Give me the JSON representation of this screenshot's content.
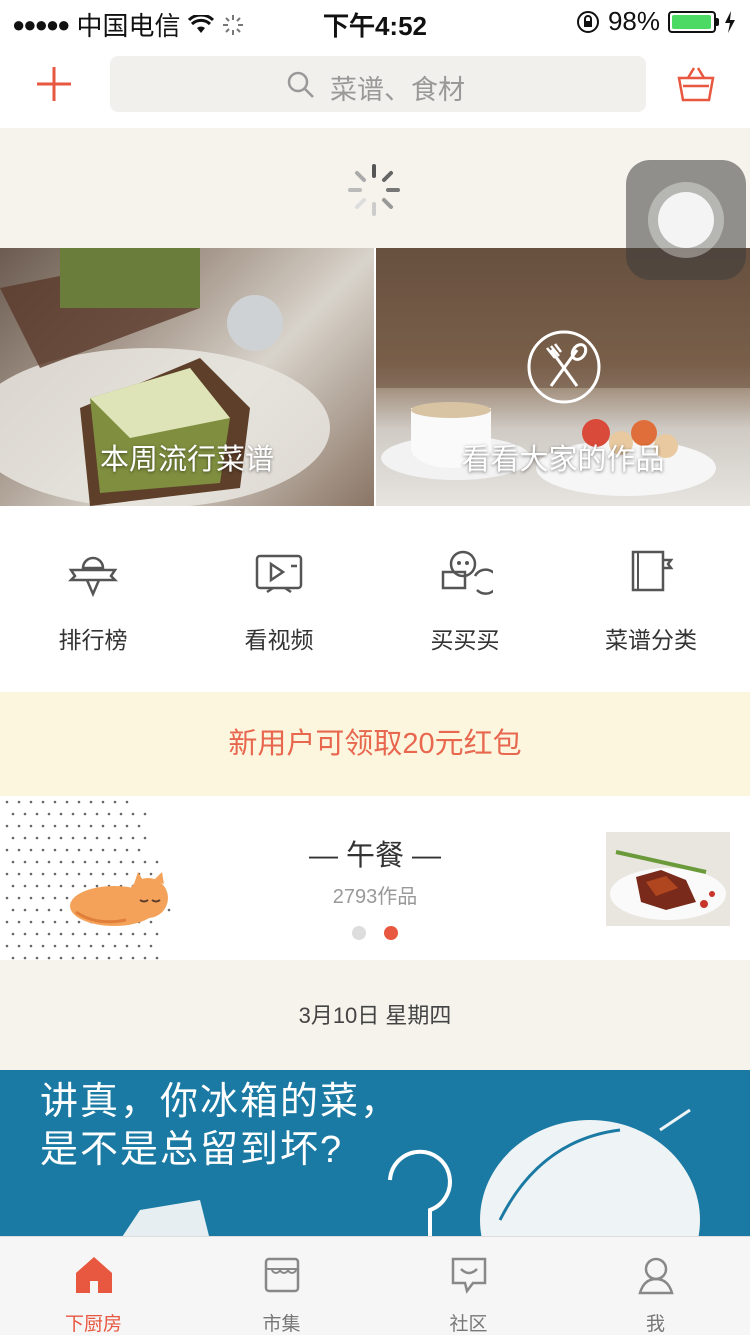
{
  "status_bar": {
    "carrier": "中国电信",
    "time": "下午4:52",
    "battery": "98%",
    "battery_level": 0.98
  },
  "header": {
    "search_placeholder": "菜谱、食材"
  },
  "banners": [
    {
      "label": "本周流行菜谱"
    },
    {
      "label": "看看大家的作品"
    }
  ],
  "quick_menu": [
    {
      "label": "排行榜",
      "icon": "ranking-icon"
    },
    {
      "label": "看视频",
      "icon": "video-icon"
    },
    {
      "label": "买买买",
      "icon": "shopping-icon"
    },
    {
      "label": "菜谱分类",
      "icon": "category-icon"
    }
  ],
  "promo": {
    "text": "新用户可领取20元红包"
  },
  "meal_card": {
    "title": "— 午餐 —",
    "count": "2793作品"
  },
  "date_line": "3月10日 星期四",
  "article": {
    "line1": "讲真，你冰箱的菜，",
    "line2": "是不是总留到坏?"
  },
  "tab_bar": [
    {
      "label": "下厨房",
      "active": true
    },
    {
      "label": "市集",
      "active": false
    },
    {
      "label": "社区",
      "active": false
    },
    {
      "label": "我",
      "active": false
    }
  ],
  "colors": {
    "accent": "#e8573f",
    "promo_bg": "#fdf6df",
    "promo_text": "#e8684f",
    "article_bg": "#1a7aa3",
    "page_bg": "#f5f3ec"
  }
}
